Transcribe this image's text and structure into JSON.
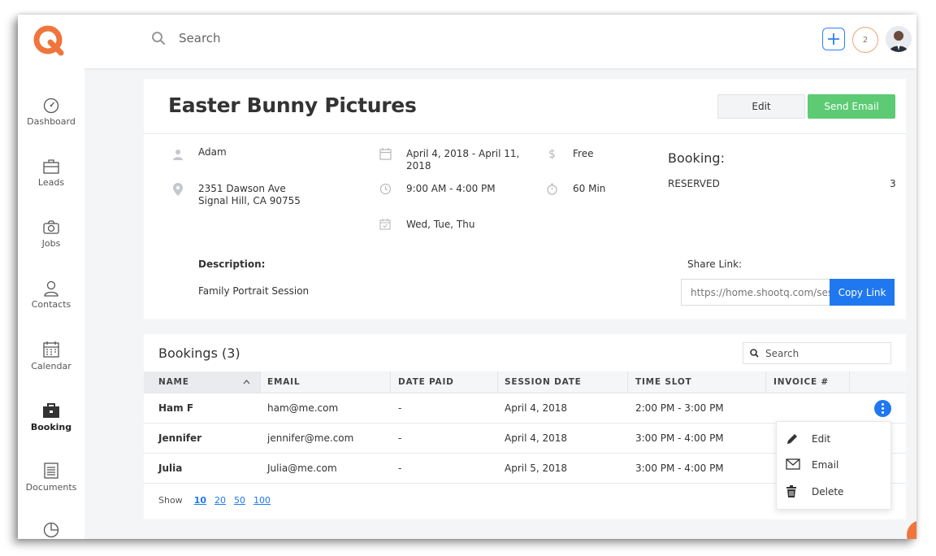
{
  "app": {
    "brand_color": "#f0753c",
    "accent": "#1f78f0",
    "success": "#5ccb74"
  },
  "topbar": {
    "search_label": "Search",
    "notification_count": "2"
  },
  "sidebar": {
    "items": [
      {
        "label": "Dashboard",
        "icon": "dashboard-icon"
      },
      {
        "label": "Leads",
        "icon": "briefcase-icon"
      },
      {
        "label": "Jobs",
        "icon": "camera-icon"
      },
      {
        "label": "Contacts",
        "icon": "person-icon"
      },
      {
        "label": "Calendar",
        "icon": "calendar-icon"
      },
      {
        "label": "Booking",
        "icon": "booking-briefcase-icon",
        "active": true
      },
      {
        "label": "Documents",
        "icon": "document-icon"
      },
      {
        "label": "",
        "icon": "pie-chart-icon"
      }
    ]
  },
  "job": {
    "title": "Easter Bunny Pictures",
    "edit_label": "Edit",
    "send_email_label": "Send Email",
    "contact": "Adam",
    "address_line1": "2351 Dawson Ave",
    "address_line2": "Signal Hill, CA 90755",
    "date_range_line1": "April 4, 2018 - April 11,",
    "date_range_line2": "2018",
    "time_range": "9:00 AM - 4:00 PM",
    "days": "Wed, Tue, Thu",
    "price": "Free",
    "duration": "60 Min",
    "booking_heading": "Booking:",
    "booking_status": "RESERVED",
    "booking_count": "3",
    "description_label": "Description:",
    "description": "Family Portrait Session",
    "share_label": "Share Link:",
    "share_url": "https://home.shootq.com/sess",
    "copy_label": "Copy Link"
  },
  "bookings": {
    "title": "Bookings (3)",
    "search_label": "Search",
    "columns": [
      "NAME",
      "EMAIL",
      "DATE PAID",
      "SESSION DATE",
      "TIME SLOT",
      "INVOICE #"
    ],
    "rows": [
      {
        "name": "Ham F",
        "email": "ham@me.com",
        "date_paid": "-",
        "session_date": "April 4, 2018",
        "time_slot": "2:00 PM - 3:00 PM",
        "invoice": ""
      },
      {
        "name": "Jennifer",
        "email": "jennifer@me.com",
        "date_paid": "-",
        "session_date": "April 4, 2018",
        "time_slot": "3:00 PM - 4:00 PM",
        "invoice": ""
      },
      {
        "name": "Julia",
        "email": "Julia@me.com",
        "date_paid": "-",
        "session_date": "April 5, 2018",
        "time_slot": "3:00 PM - 4:00 PM",
        "invoice": ""
      }
    ],
    "show_label": "Show",
    "page_sizes": [
      "10",
      "20",
      "50",
      "100"
    ],
    "menu": [
      {
        "label": "Edit",
        "icon": "pencil-icon"
      },
      {
        "label": "Email",
        "icon": "envelope-icon"
      },
      {
        "label": "Delete",
        "icon": "trash-icon"
      }
    ]
  }
}
